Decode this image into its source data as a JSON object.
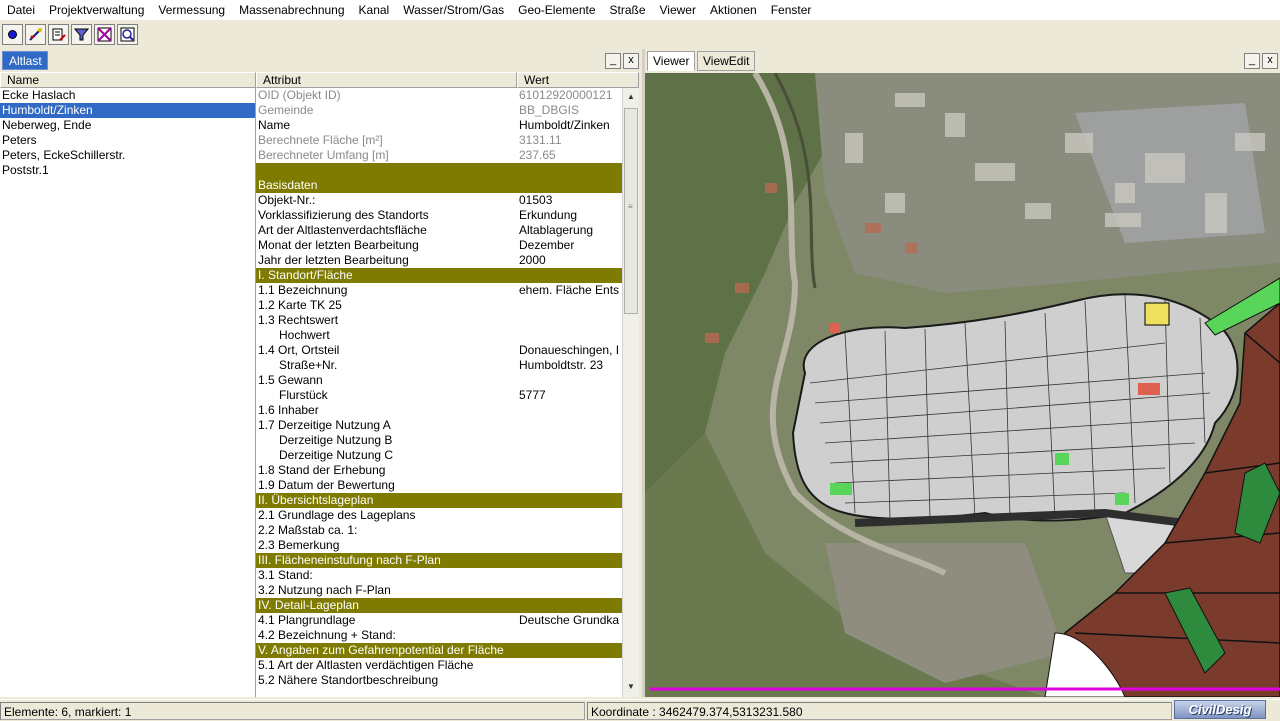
{
  "menu": [
    "Datei",
    "Projektverwaltung",
    "Vermessung",
    "Massenabrechnung",
    "Kanal",
    "Wasser/Strom/Gas",
    "Geo-Elemente",
    "Straße",
    "Viewer",
    "Aktionen",
    "Fenster"
  ],
  "toolbar": {
    "icons": [
      "point-tool-icon",
      "edit-pencil-icon",
      "document-edit-icon",
      "filter-icon",
      "zoom-select-icon",
      "zoom-region-icon"
    ]
  },
  "left_panel": {
    "tab_label": "Altlast",
    "minimize_label": "_",
    "close_label": "x",
    "columns": {
      "name": "Name",
      "attribute": "Attribut",
      "value": "Wert"
    },
    "names": [
      "Ecke Haslach",
      "Humboldt/Zinken",
      "Neberweg, Ende",
      "Peters",
      "Peters, EckeSchillerstr.",
      "Poststr.1"
    ],
    "selected_index": 1,
    "rows": [
      {
        "attr": "OID (Objekt ID)",
        "value": "61012920000121",
        "style": "grey"
      },
      {
        "attr": "Gemeinde",
        "value": "BB_DBGIS",
        "style": "grey"
      },
      {
        "attr": "Name",
        "value": "Humboldt/Zinken",
        "style": "normal"
      },
      {
        "attr": "Berechnete Fläche [m²]",
        "value": "3131.11",
        "style": "grey"
      },
      {
        "attr": "Berechneter Umfang [m]",
        "value": "237.65",
        "style": "grey"
      },
      {
        "attr": "",
        "value": "",
        "style": "section"
      },
      {
        "attr": "Basisdaten",
        "value": "",
        "style": "section"
      },
      {
        "attr": "Objekt-Nr.:",
        "value": "01503",
        "style": "normal"
      },
      {
        "attr": "Vorklassifizierung des Standorts",
        "value": "Erkundung",
        "style": "normal"
      },
      {
        "attr": "Art der Altlastenverdachtsfläche",
        "value": "Altablagerung",
        "style": "normal"
      },
      {
        "attr": "Monat der letzten Bearbeitung",
        "value": "Dezember",
        "style": "normal"
      },
      {
        "attr": "Jahr der letzten Bearbeitung",
        "value": "2000",
        "style": "normal"
      },
      {
        "attr": "I. Standort/Fläche",
        "value": "",
        "style": "section"
      },
      {
        "attr": "1.1 Bezeichnung",
        "value": "ehem. Fläche Ents",
        "style": "normal"
      },
      {
        "attr": "1.2 Karte TK 25",
        "value": "",
        "style": "normal"
      },
      {
        "attr": "1.3 Rechtswert",
        "value": "",
        "style": "normal"
      },
      {
        "attr": "Hochwert",
        "value": "",
        "style": "indent"
      },
      {
        "attr": "1.4 Ort, Ortsteil",
        "value": "Donaueschingen, I",
        "style": "normal"
      },
      {
        "attr": "Straße+Nr.",
        "value": "Humboldtstr. 23",
        "style": "indent"
      },
      {
        "attr": "1.5 Gewann",
        "value": "",
        "style": "normal"
      },
      {
        "attr": "Flurstück",
        "value": "5777",
        "style": "indent"
      },
      {
        "attr": "1.6 Inhaber",
        "value": "",
        "style": "normal"
      },
      {
        "attr": "1.7 Derzeitige Nutzung A",
        "value": "",
        "style": "normal"
      },
      {
        "attr": "Derzeitige Nutzung B",
        "value": "",
        "style": "indent"
      },
      {
        "attr": "Derzeitige Nutzung C",
        "value": "",
        "style": "indent"
      },
      {
        "attr": "1.8 Stand der Erhebung",
        "value": "",
        "style": "normal"
      },
      {
        "attr": "1.9 Datum der Bewertung",
        "value": "",
        "style": "normal"
      },
      {
        "attr": "II. Übersichtslageplan",
        "value": "",
        "style": "section"
      },
      {
        "attr": "2.1 Grundlage des Lageplans",
        "value": "",
        "style": "normal"
      },
      {
        "attr": "2.2 Maßstab ca. 1:",
        "value": "",
        "style": "normal"
      },
      {
        "attr": "2.3 Bemerkung",
        "value": "",
        "style": "normal"
      },
      {
        "attr": "III. Flächeneinstufung nach F-Plan",
        "value": "",
        "style": "section"
      },
      {
        "attr": "3.1 Stand:",
        "value": "",
        "style": "normal"
      },
      {
        "attr": "3.2 Nutzung nach F-Plan",
        "value": "",
        "style": "normal"
      },
      {
        "attr": "IV. Detail-Lageplan",
        "value": "",
        "style": "section"
      },
      {
        "attr": "4.1 Plangrundlage",
        "value": "Deutsche Grundka",
        "style": "normal"
      },
      {
        "attr": "4.2 Bezeichnung + Stand:",
        "value": "",
        "style": "normal"
      },
      {
        "attr": "V. Angaben zum Gefahrenpotential der Fläche",
        "value": "",
        "style": "section"
      },
      {
        "attr": "5.1 Art der Altlasten verdächtigen Fläche",
        "value": "",
        "style": "normal"
      },
      {
        "attr": "5.2 Nähere Standortbeschreibung",
        "value": "",
        "style": "normal"
      }
    ]
  },
  "right_panel": {
    "tabs": [
      "Viewer",
      "ViewEdit"
    ],
    "active_tab": 0,
    "minimize_label": "_",
    "close_label": "x"
  },
  "status": {
    "elements": "Elemente: 6, markiert: 1",
    "coordinate": "Koordinate : 3462479.374,5313231.580",
    "logo": "CivilDesig"
  },
  "colors": {
    "selection": "#316ac5",
    "section_row": "#7f7b00",
    "parcel_brown": "#7a3a2c",
    "parcel_green": "#2e8b3e",
    "highlight_magenta": "#e000e0"
  }
}
